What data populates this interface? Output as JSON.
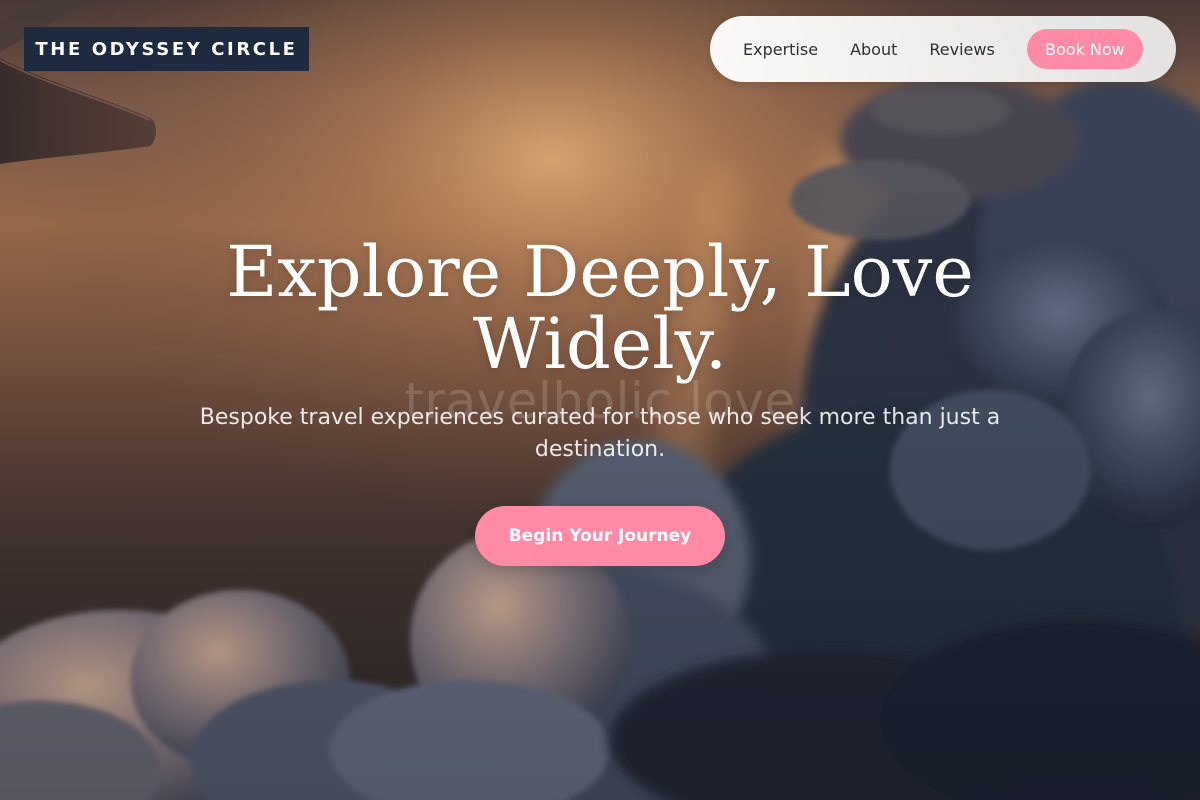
{
  "brand": {
    "name": "THE ODYSSEY CIRCLE"
  },
  "nav": {
    "items": [
      {
        "label": "Expertise"
      },
      {
        "label": "About"
      },
      {
        "label": "Reviews"
      }
    ],
    "cta_label": "Book Now"
  },
  "hero": {
    "headline_line1": "Explore Deeply, Love",
    "headline_line2": "Widely.",
    "watermark": "travelholic.love",
    "subtitle": "Bespoke travel experiences curated for those who seek more than just a destination.",
    "cta_label": "Begin Your Journey"
  },
  "colors": {
    "accent": "#ff8aa6",
    "brand_bg": "#1e2a3d",
    "nav_bg": "#f4f4f4"
  },
  "icons": {
    "background": "sunset-clouds-airplane-wing-photo"
  }
}
